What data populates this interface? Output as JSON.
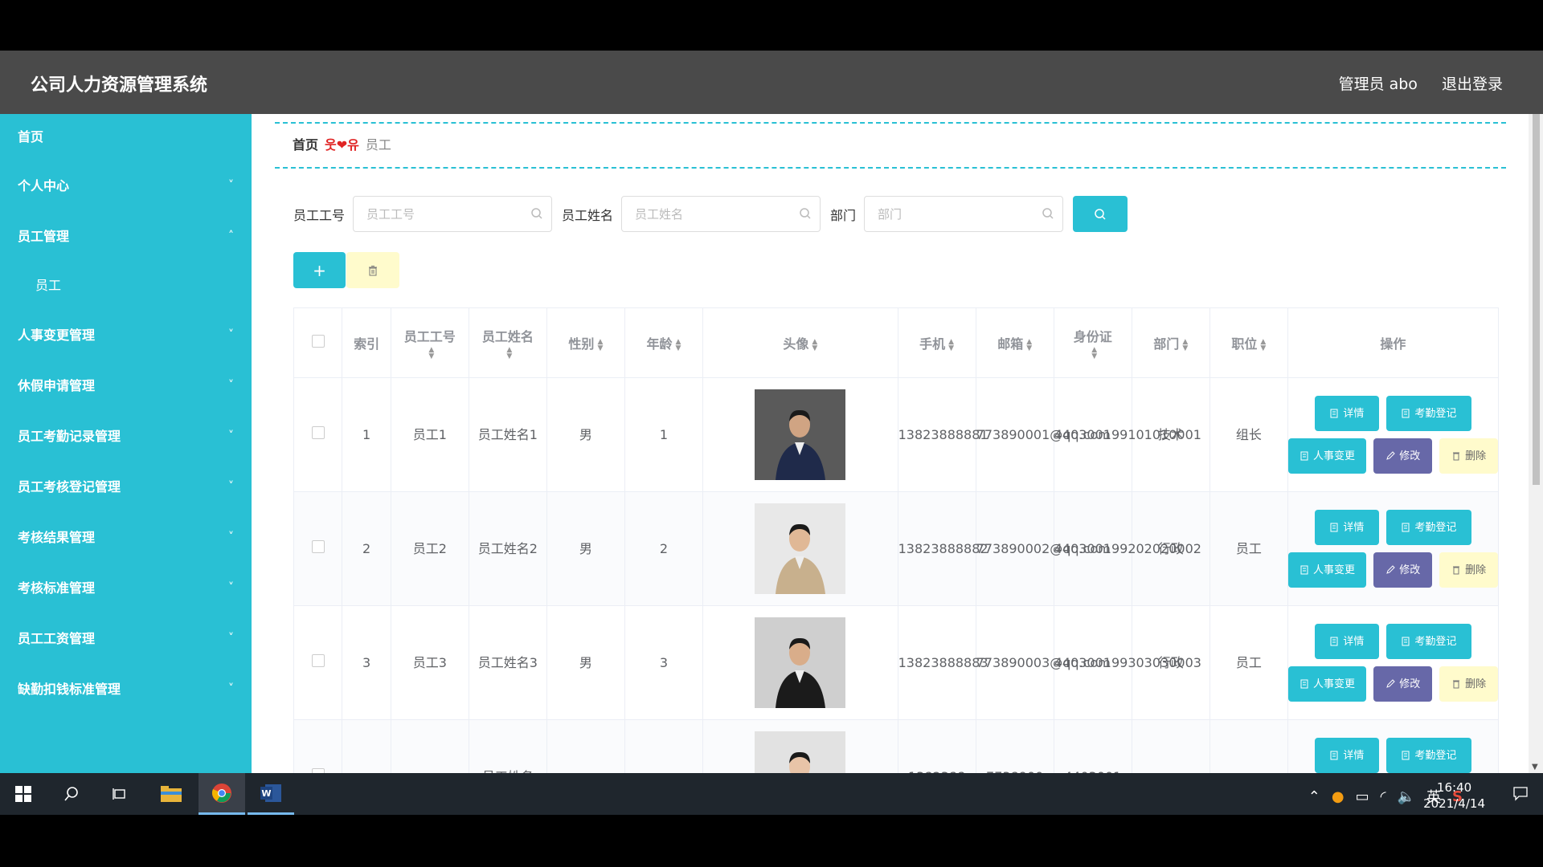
{
  "header": {
    "title": "公司人力资源管理系统",
    "user": "管理员 abo",
    "logout": "退出登录"
  },
  "sidebar": {
    "items": [
      {
        "label": "首页",
        "chevron": ""
      },
      {
        "label": "个人中心",
        "chevron": "˅"
      },
      {
        "label": "员工管理",
        "chevron": "˄"
      },
      {
        "label": "员工",
        "chevron": ""
      },
      {
        "label": "人事变更管理",
        "chevron": "˅"
      },
      {
        "label": "休假申请管理",
        "chevron": "˅"
      },
      {
        "label": "员工考勤记录管理",
        "chevron": "˅"
      },
      {
        "label": "员工考核登记管理",
        "chevron": "˅"
      },
      {
        "label": "考核结果管理",
        "chevron": "˅"
      },
      {
        "label": "考核标准管理",
        "chevron": "˅"
      },
      {
        "label": "员工工资管理",
        "chevron": "˅"
      },
      {
        "label": "缺勤扣钱标准管理",
        "chevron": "˅"
      }
    ]
  },
  "breadcrumb": {
    "home": "首页",
    "separator": "웃❤유",
    "current": "员工"
  },
  "search": {
    "fields": [
      {
        "label": "员工工号",
        "placeholder": "员工工号"
      },
      {
        "label": "员工姓名",
        "placeholder": "员工姓名"
      },
      {
        "label": "部门",
        "placeholder": "部门"
      }
    ]
  },
  "actions": {
    "add": "+"
  },
  "table": {
    "headers": {
      "index": "索引",
      "emp_no": "员工工号",
      "emp_name": "员工姓名",
      "gender": "性别",
      "age": "年龄",
      "avatar": "头像",
      "phone": "手机",
      "email": "邮箱",
      "id_card": "身份证",
      "dept": "部门",
      "position": "职位",
      "ops": "操作"
    },
    "ops_labels": {
      "detail": "详情",
      "attendance": "考勤登记",
      "personnel": "人事变更",
      "edit": "修改",
      "delete": "删除"
    },
    "rows": [
      {
        "index": "1",
        "emp_no": "员工1",
        "emp_name": "员工姓名1",
        "gender": "男",
        "age": "1",
        "phone": "13823888881",
        "email": "773890001@qq.com",
        "id_card": "440300199101010001",
        "dept": "技术",
        "position": "组长"
      },
      {
        "index": "2",
        "emp_no": "员工2",
        "emp_name": "员工姓名2",
        "gender": "男",
        "age": "2",
        "phone": "13823888882",
        "email": "773890002@qq.com",
        "id_card": "440300199202020002",
        "dept": "行政",
        "position": "员工"
      },
      {
        "index": "3",
        "emp_no": "员工3",
        "emp_name": "员工姓名3",
        "gender": "男",
        "age": "3",
        "phone": "13823888883",
        "email": "773890003@qq.com",
        "id_card": "440300199303030003",
        "dept": "行政",
        "position": "员工"
      },
      {
        "index": "",
        "emp_no": "",
        "emp_name": "员工姓名",
        "gender": "",
        "age": "",
        "phone": "1382388",
        "email": "7738900",
        "id_card": "4403001",
        "dept": "",
        "position": ""
      }
    ]
  },
  "taskbar": {
    "ime": "英",
    "time": "16:40",
    "date": "2021/4/14"
  },
  "colors": {
    "accent": "#29c0d4",
    "edit": "#6768a8",
    "delete_bg": "#fffbcc",
    "header_bg": "#4a4a4a",
    "taskbar_bg": "#1f262d"
  },
  "icons": [
    "search-icon",
    "trash-icon",
    "doc-icon",
    "pencil-icon",
    "windows-icon",
    "chrome-icon",
    "word-icon",
    "folder-icon"
  ]
}
